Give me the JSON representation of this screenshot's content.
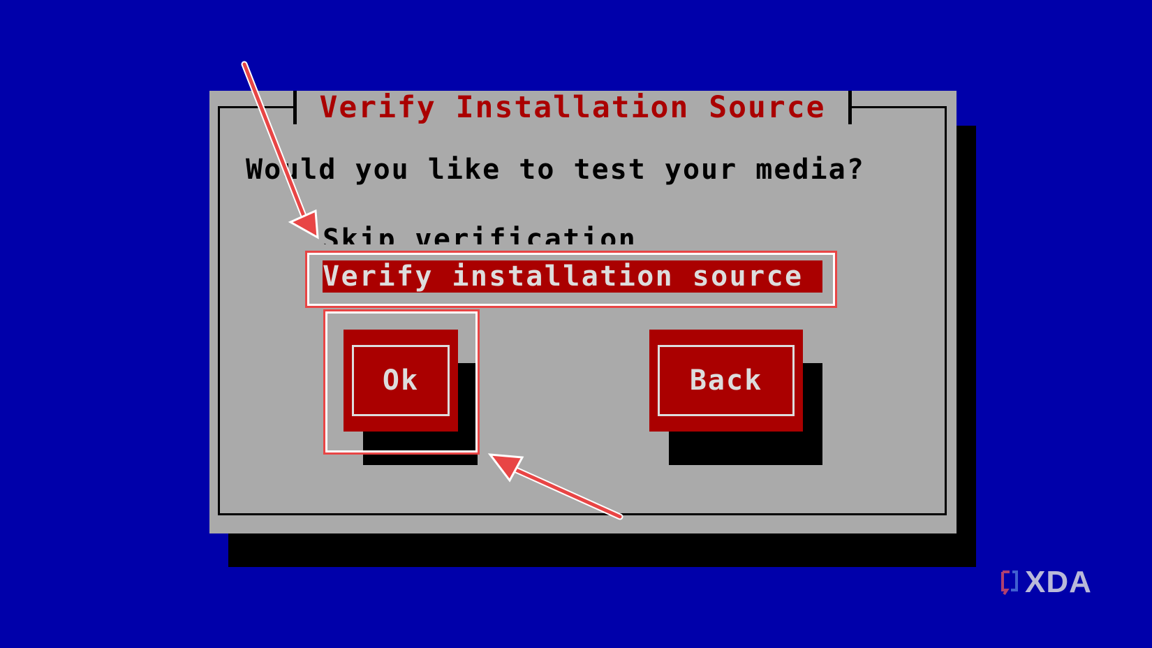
{
  "dialog": {
    "title": "Verify Installation Source",
    "question": "Would you like to test your media?",
    "options": [
      {
        "label": "Skip verification",
        "selected": false
      },
      {
        "label": "Verify installation source",
        "selected": true
      }
    ],
    "buttons": {
      "ok_label": "Ok",
      "back_label": "Back"
    }
  },
  "watermark": {
    "text": "XDA"
  },
  "colors": {
    "background": "#0000aa",
    "dialog": "#aaaaaa",
    "accent": "#aa0000",
    "annotation": "#e84545"
  },
  "icons": {
    "watermark_logo": "xda-logo-icon",
    "annotation_arrows": "arrow-icon"
  }
}
